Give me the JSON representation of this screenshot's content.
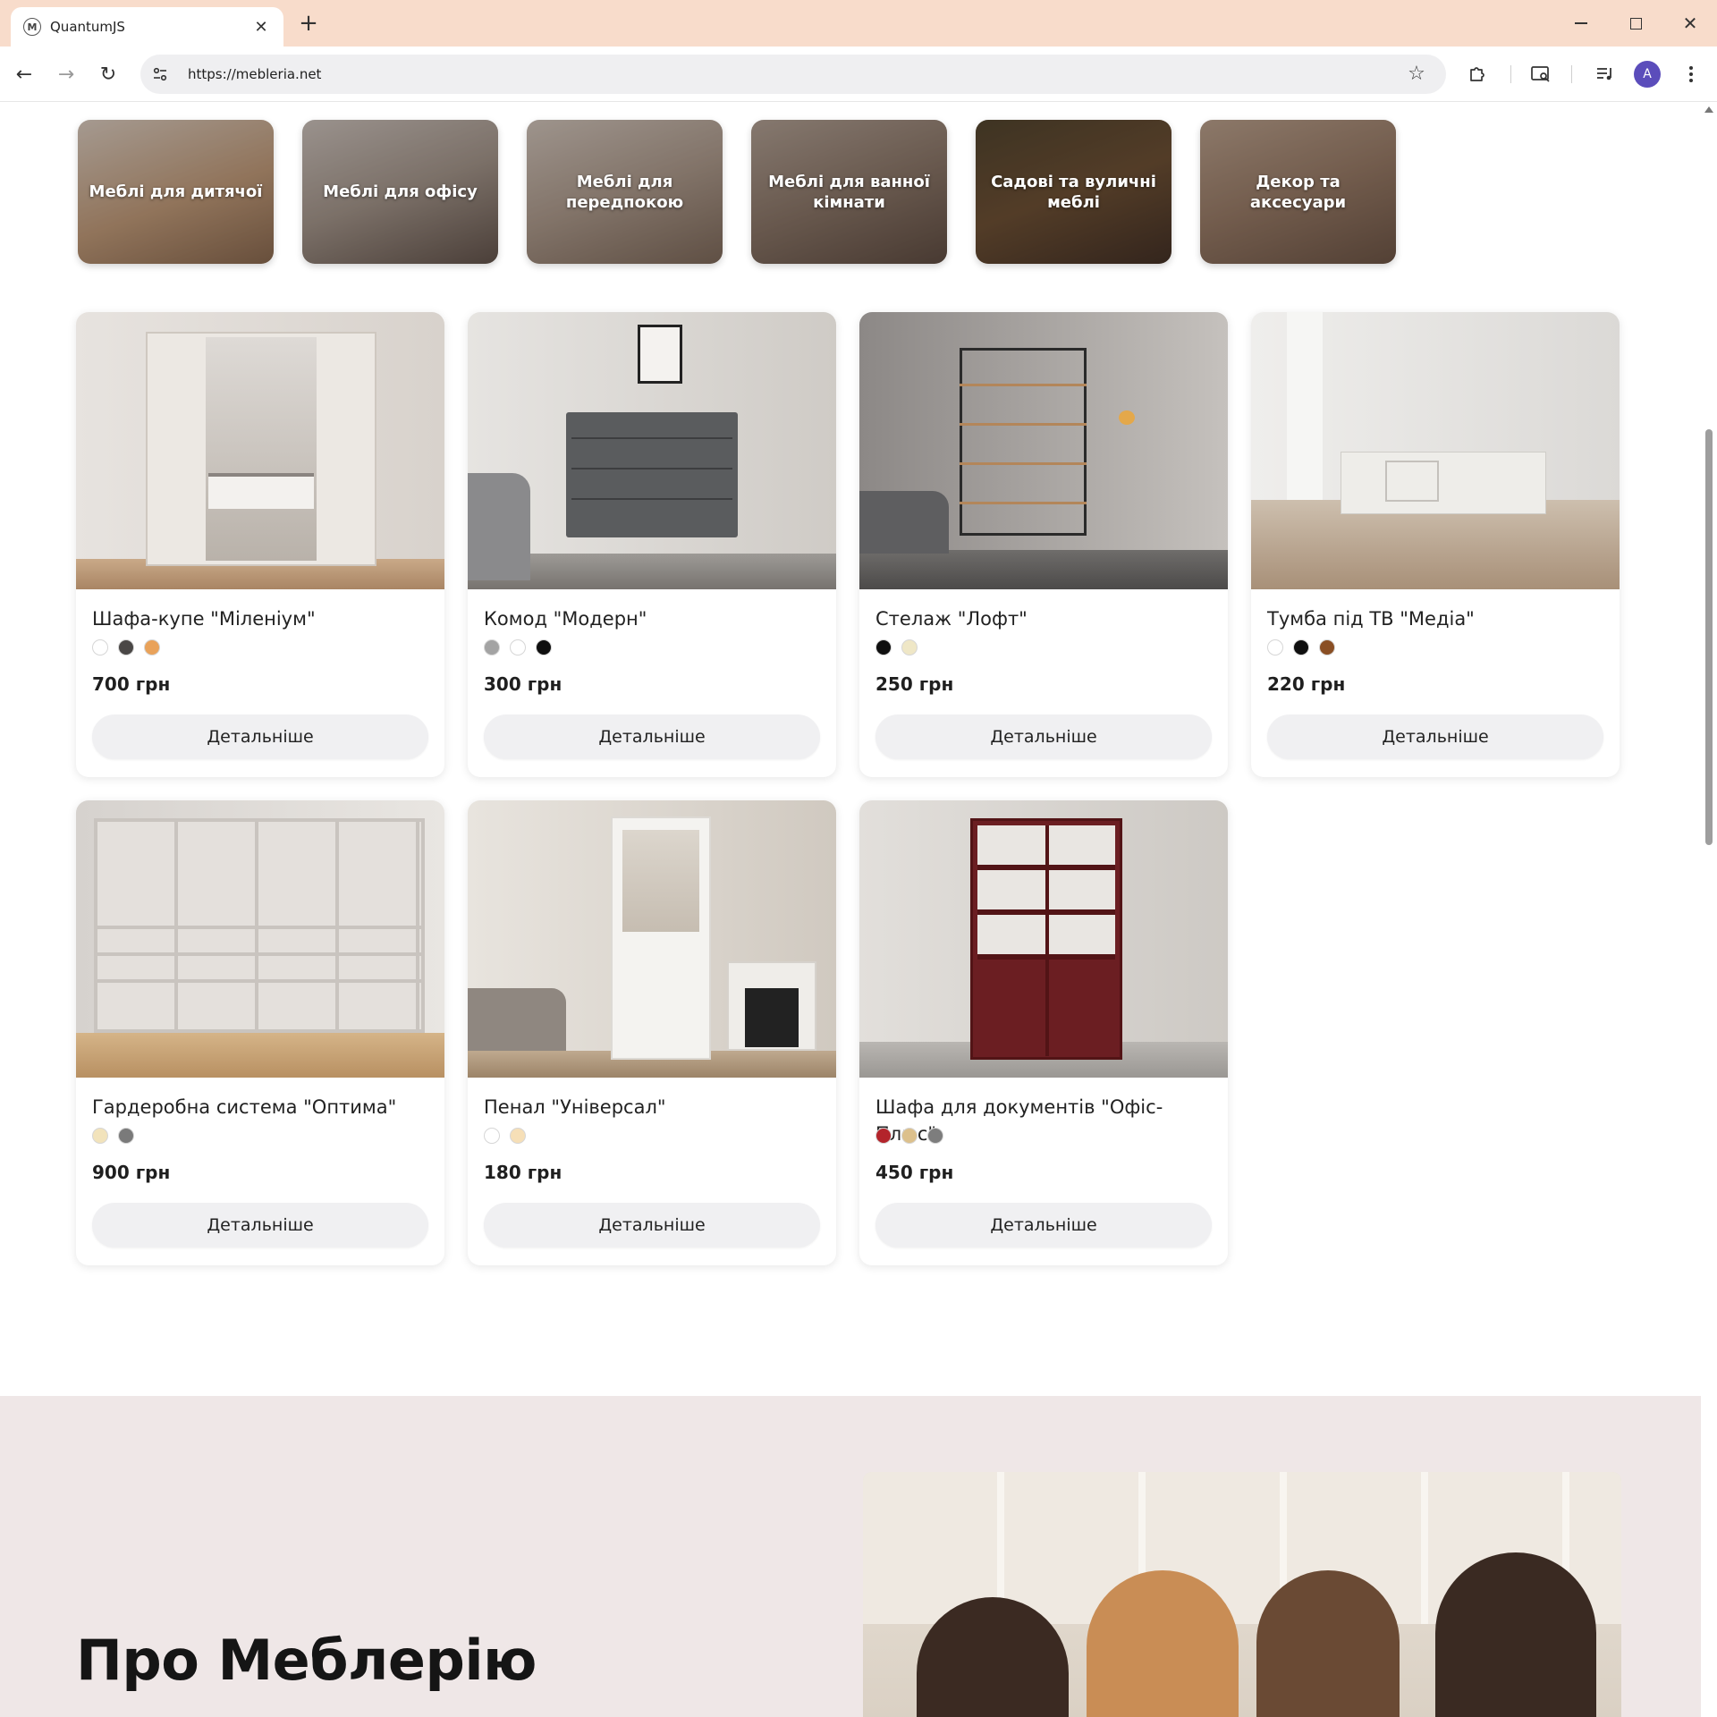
{
  "browser": {
    "tab_title": "QuantumJS",
    "tab_favicon": "M",
    "url": "https://mebleria.net",
    "avatar_letter": "A"
  },
  "categories": [
    {
      "label": "Меблі для дитячої"
    },
    {
      "label": "Меблі для офісу"
    },
    {
      "label": "Меблі для передпокою"
    },
    {
      "label": "Меблі для ванної кімнати"
    },
    {
      "label": "Садові та вуличні меблі"
    },
    {
      "label": "Декор та аксесуари"
    }
  ],
  "products": [
    {
      "title": "Шафа-купе \"Мілeніум\"",
      "price": "700 грн",
      "button": "Детальніше",
      "swatches": [
        "#ffffff",
        "#4a4746",
        "#e9a25a"
      ]
    },
    {
      "title": "Комод \"Модерн\"",
      "price": "300 грн",
      "button": "Детальніше",
      "swatches": [
        "#a3a3a3",
        "#ffffff",
        "#0f0f0f"
      ]
    },
    {
      "title": "Стелаж \"Лофт\"",
      "price": "250 грн",
      "button": "Детальніше",
      "swatches": [
        "#0f0f0f",
        "#efe7c6"
      ]
    },
    {
      "title": "Тумба під ТВ \"Медіа\"",
      "price": "220 грн",
      "button": "Детальніше",
      "swatches": [
        "#ffffff",
        "#0f0f0f",
        "#8a4f24"
      ]
    },
    {
      "title": "Гардеробна система \"Оптима\"",
      "price": "900 грн",
      "button": "Детальніше",
      "swatches": [
        "#f2e3bb",
        "#7a7a7a"
      ]
    },
    {
      "title": "Пенал \"Універсал\"",
      "price": "180 грн",
      "button": "Детальніше",
      "swatches": [
        "#ffffff",
        "#f6dfb7"
      ]
    },
    {
      "title": "Шафа для документів \"Офіс-Плюс\"",
      "price": "450 грн",
      "button": "Детальніше",
      "swatches": [
        "#b3242b",
        "#dcc08c",
        "#7d7d7d"
      ]
    }
  ],
  "about": {
    "title": "Про Меблерію"
  }
}
